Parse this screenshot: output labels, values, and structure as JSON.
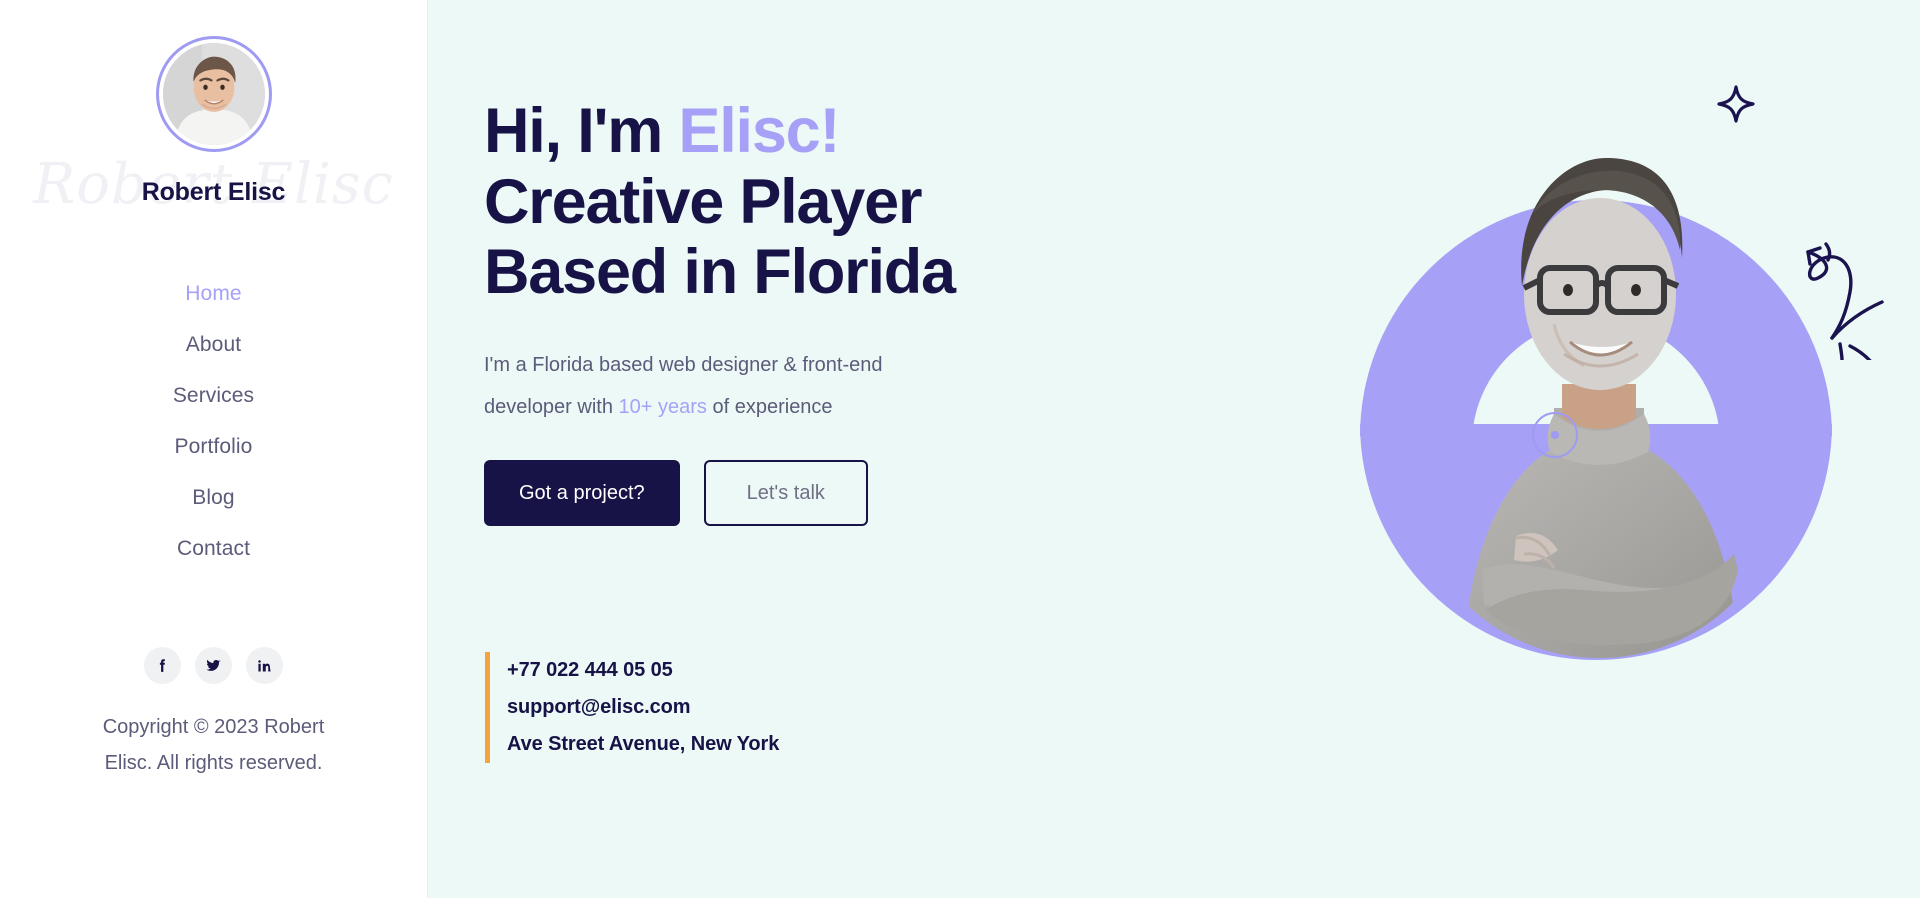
{
  "theme": {
    "accent_purple": "#a6a1f7",
    "dark_navy": "#171347",
    "hero_background": "#edf9f6",
    "sidebar_background": "#ffffff",
    "body_text": "#5b5b7a",
    "orange_accent": "#f5a33c",
    "social_chip_background": "#f0f1f3"
  },
  "sidebar": {
    "brand_name": "Robert Elisc",
    "script_watermark": "Robert Elisc",
    "avatar_alt": "avatar",
    "nav": [
      {
        "label": "Home",
        "active": true
      },
      {
        "label": "About",
        "active": false
      },
      {
        "label": "Services",
        "active": false
      },
      {
        "label": "Portfolio",
        "active": false
      },
      {
        "label": "Blog",
        "active": false
      },
      {
        "label": "Contact",
        "active": false
      }
    ],
    "socials": [
      {
        "name": "facebook",
        "glyph": "f"
      },
      {
        "name": "twitter",
        "glyph": "bird"
      },
      {
        "name": "linkedin",
        "glyph": "in"
      }
    ],
    "copyright": "Copyright © 2023 Robert Elisc. All rights reserved."
  },
  "hero": {
    "headline_line1_plain": "Hi, I'm ",
    "headline_line1_accent": "Elisc!",
    "headline_line2": "Creative Player",
    "headline_line3": "Based in Florida",
    "subtitle_part1": "I'm a Florida based web designer & front-end developer with ",
    "subtitle_accent": "10+ years",
    "subtitle_part2": " of experience",
    "primary_button": "Got a project?",
    "secondary_button": "Let's talk",
    "contact": {
      "phone": "+77 022 444 05 05",
      "email": "support@elisc.com",
      "address": "Ave Street Avenue, New York"
    },
    "decorations": [
      "sparkle-icon",
      "sparkle-icon",
      "sparkle-icon",
      "curved-arrow-doodle",
      "purple-arch-shape",
      "purple-half-circle-shape",
      "ring-dot-marker"
    ]
  }
}
